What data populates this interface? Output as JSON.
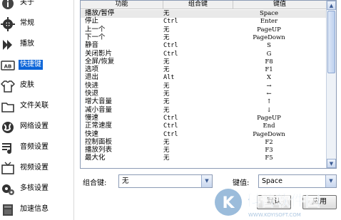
{
  "sidebar": {
    "items": [
      {
        "label": "关于",
        "icon": "info-icon"
      },
      {
        "label": "常规",
        "icon": "gear-icon"
      },
      {
        "label": "播放",
        "icon": "play-icon"
      },
      {
        "label": "快捷键",
        "icon": "keyboard-icon"
      },
      {
        "label": "皮肤",
        "icon": "shirt-icon"
      },
      {
        "label": "文件关联",
        "icon": "folder-icon"
      },
      {
        "label": "网络设置",
        "icon": "globe-icon"
      },
      {
        "label": "音频设置",
        "icon": "audio-icon"
      },
      {
        "label": "视频设置",
        "icon": "tv-icon"
      },
      {
        "label": "多核设置",
        "icon": "multicore-icon"
      },
      {
        "label": "加速信息",
        "icon": "accelerate-icon"
      }
    ],
    "active_index": 3
  },
  "table": {
    "headers": [
      "功能",
      "组合键",
      "键值"
    ],
    "rows": [
      [
        "播放/暂停",
        "无",
        "Space"
      ],
      [
        "停止",
        "Ctrl",
        "Enter"
      ],
      [
        "上一个",
        "无",
        "PageUP"
      ],
      [
        "下一个",
        "无",
        "PageDown"
      ],
      [
        "静音",
        "Ctrl",
        "S"
      ],
      [
        "关闭影片",
        "Ctrl",
        "G"
      ],
      [
        "全屏/恢复",
        "无",
        "F8"
      ],
      [
        "选项",
        "无",
        "F1"
      ],
      [
        "退出",
        "Alt",
        "X"
      ],
      [
        "快进",
        "无",
        "→"
      ],
      [
        "快退",
        "无",
        "←"
      ],
      [
        "增大音量",
        "无",
        "↑"
      ],
      [
        "减小音量",
        "无",
        "↓"
      ],
      [
        "慢速",
        "Ctrl",
        "PageUP"
      ],
      [
        "正常速度",
        "Ctrl",
        "End"
      ],
      [
        "快速",
        "Ctrl",
        "PageDown"
      ],
      [
        "控制面板",
        "无",
        "F2"
      ],
      [
        "播放列表",
        "无",
        "F3"
      ],
      [
        "最大化",
        "无",
        "F5"
      ]
    ],
    "selected_index": 0
  },
  "controls": {
    "combo_label": "组合键:",
    "combo_value": "无",
    "key_label": "键值:",
    "key_value": "Space",
    "btn_default": "默认",
    "btn_apply": "应用"
  },
  "watermark": {
    "logo_letter": "K",
    "text": "科普软件园",
    "url": "WWW.KOYISOFT.COM"
  },
  "colors": {
    "accent": "#0a64d8",
    "selected_row": "#e9e9e9",
    "border": "#8c9bb5"
  }
}
